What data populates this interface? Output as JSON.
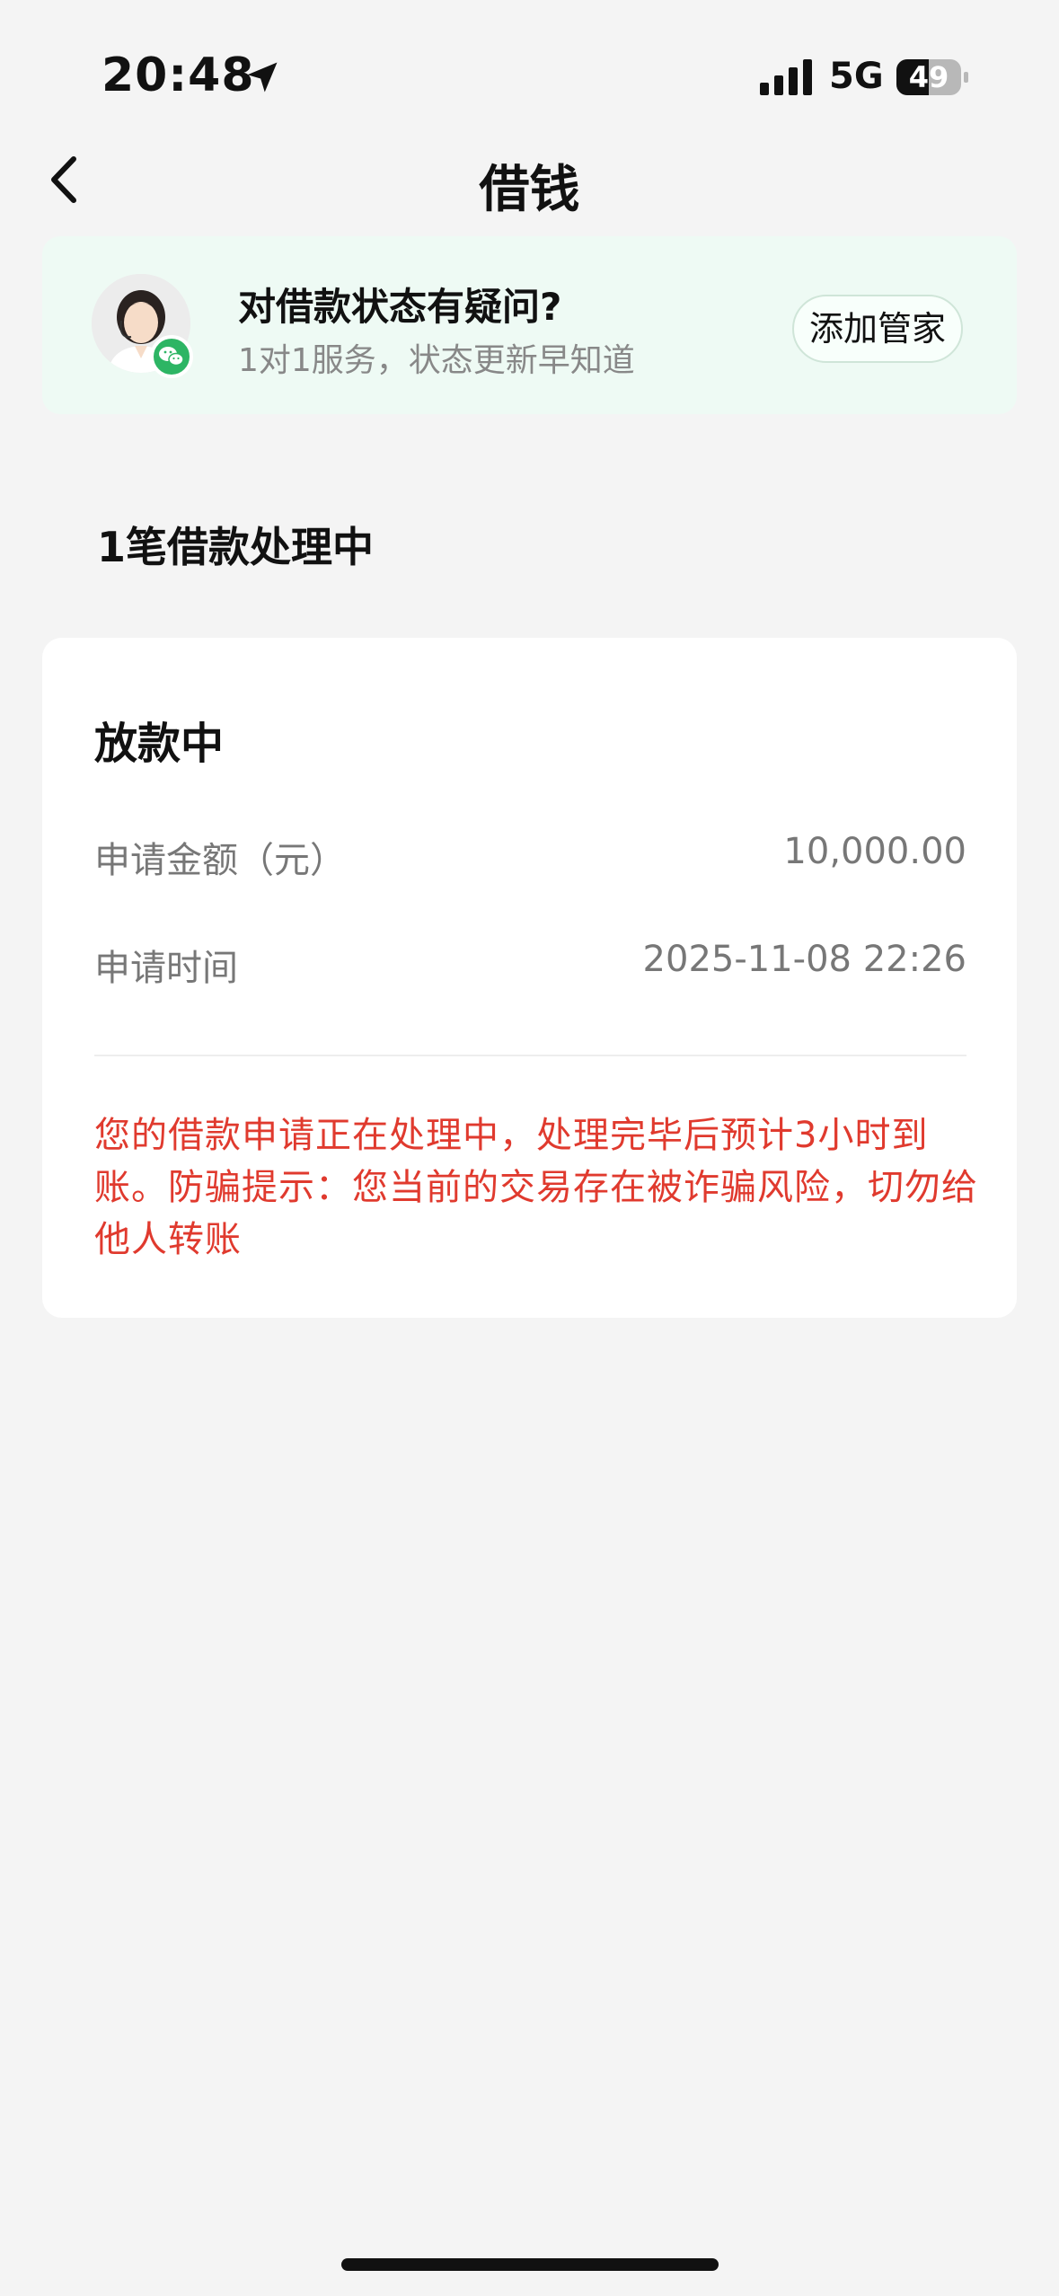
{
  "status_bar": {
    "time": "20:48",
    "network": "5G",
    "battery": "49",
    "icons": [
      "location-arrow-icon",
      "signal-icon",
      "battery-icon"
    ]
  },
  "nav": {
    "title": "借钱",
    "back_icon": "chevron-left-icon"
  },
  "banner": {
    "title": "对借款状态有疑问?",
    "subtitle": "1对1服务，状态更新早知道",
    "button": "添加管家",
    "avatar_icon": "customer-service-avatar",
    "badge_icon": "wechat-icon",
    "background_color": "#eefaf4",
    "badge_color": "#2db564"
  },
  "section_title": "1笔借款处理中",
  "loan_card": {
    "status": "放款中",
    "rows": [
      {
        "label": "申请金额（元）",
        "value": "10,000.00"
      },
      {
        "label": "申请时间",
        "value": "2025-11-08 22:26"
      }
    ],
    "notice": "您的借款申请正在处理中，处理完毕后预计3小时到账。防骗提示：您当前的交易存在被诈骗风险，切勿给他人转账",
    "notice_color": "#e03a2e"
  }
}
